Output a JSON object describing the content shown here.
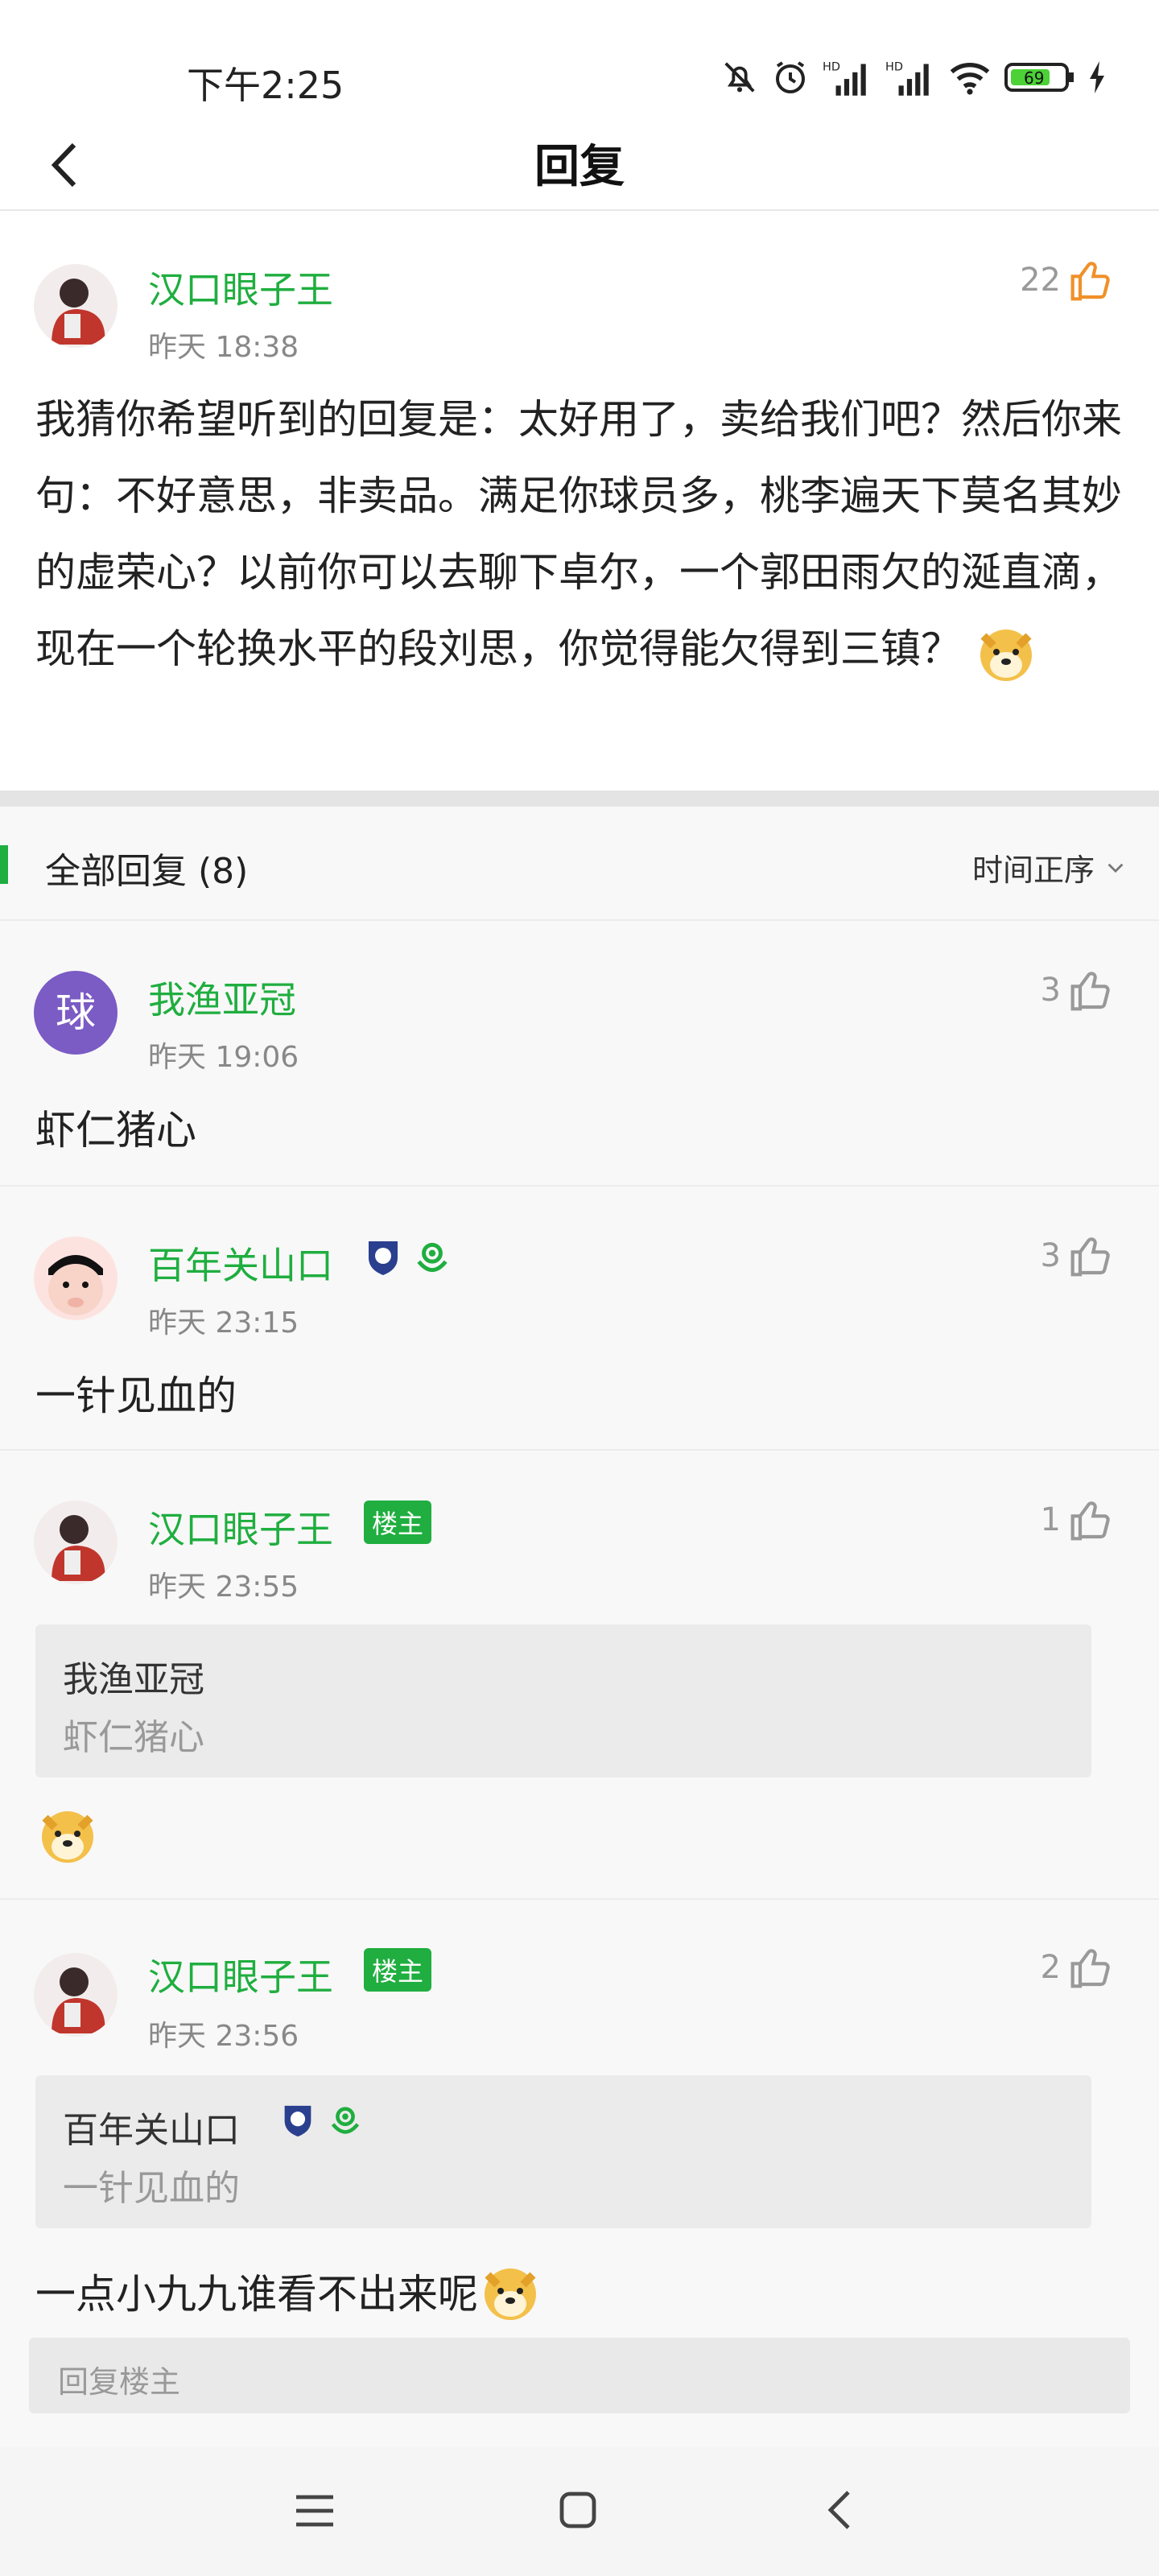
{
  "status_bar": {
    "time": "下午2:25",
    "battery": "69",
    "icons": [
      "bell-off-icon",
      "alarm-icon",
      "signal-icon",
      "signal-icon",
      "wifi-icon",
      "battery-icon",
      "charging-icon"
    ]
  },
  "header": {
    "title": "回复"
  },
  "main_post": {
    "username": "汉口眼子王",
    "timestamp": "昨天 18:38",
    "likes": "22",
    "text": "我猜你希望听到的回复是：太好用了，卖给我们吧？然后你来句：不好意思，非卖品。满足你球员多，桃李遍天下莫名其妙的虚荣心？以前你可以去聊下卓尔，一个郭田雨欠的涎直滴，现在一个轮换水平的段刘思，你觉得能欠得到三镇？"
  },
  "section": {
    "title": "全部回复 (8)",
    "sort_label": "时间正序"
  },
  "replies": [
    {
      "username": "我渔亚冠",
      "avatar_char": "球",
      "timestamp": "昨天 19:06",
      "likes": "3",
      "text": "虾仁猪心"
    },
    {
      "username": "百年关山口",
      "timestamp": "昨天 23:15",
      "likes": "3",
      "text": "一针见血的"
    },
    {
      "username": "汉口眼子王",
      "badge": "楼主",
      "timestamp": "昨天 23:55",
      "likes": "1",
      "quote": {
        "username": "我渔亚冠",
        "text": "虾仁猪心"
      }
    },
    {
      "username": "汉口眼子王",
      "badge": "楼主",
      "timestamp": "昨天 23:56",
      "likes": "2",
      "quote": {
        "username": "百年关山口",
        "text": "一针见血的"
      },
      "text": "一点小九九谁看不出来呢"
    }
  ],
  "reply_input": {
    "placeholder": "回复楼主"
  },
  "colors": {
    "accent_green": "#1fae3f",
    "like_orange": "#f0902a",
    "purple_avatar": "#7b5bc4"
  }
}
